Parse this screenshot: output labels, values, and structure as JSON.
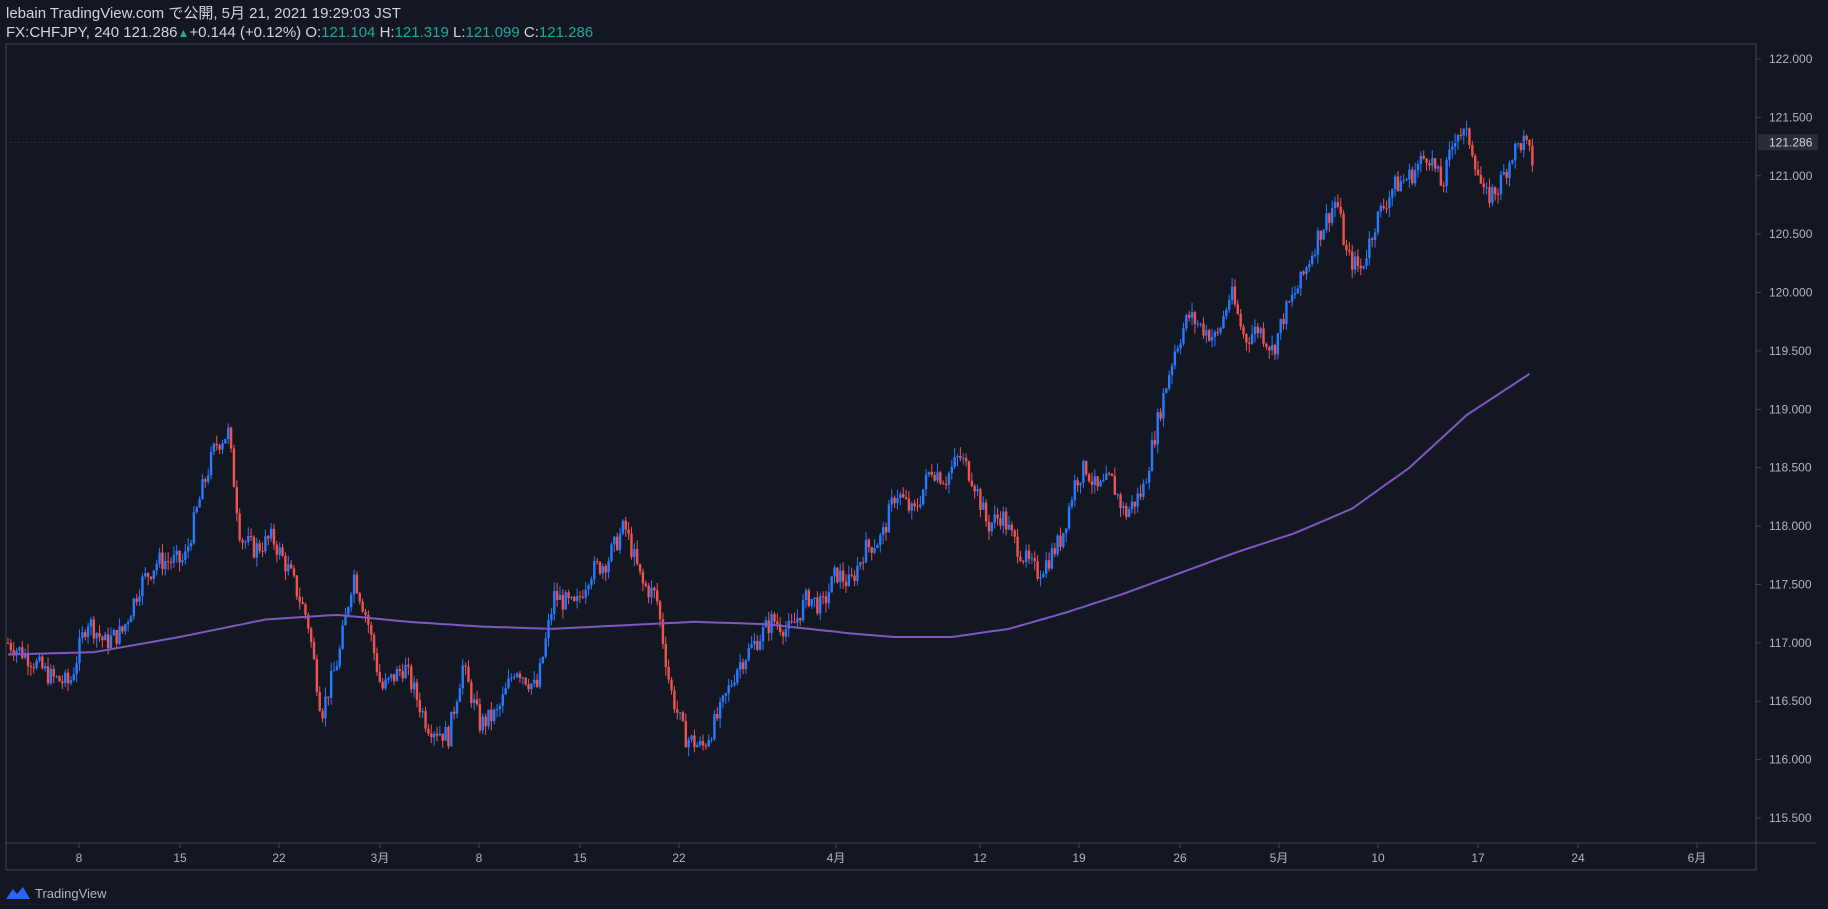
{
  "header": {
    "published": "lebain TradingView.com で公開, 5月 21, 2021 19:29:03 JST",
    "symbol": "FX:CHFJPY, 240",
    "last": "121.286",
    "change_arrow": "▲",
    "change": "+0.144 (+0.12%)",
    "o_label": "O:",
    "o_value": "121.104",
    "h_label": "H:",
    "h_value": "121.319",
    "l_label": "L:",
    "l_value": "121.099",
    "c_label": "C:",
    "c_value": "121.286"
  },
  "footer": {
    "brand": "TradingView"
  },
  "chart_data": {
    "type": "candlestick",
    "colors": {
      "up": "#2979ff",
      "down": "#ef5350",
      "ma": "#7e57c2",
      "bg": "#131722",
      "axis": "#787b86"
    },
    "y_ticks": [
      "122.000",
      "121.500",
      "121.000",
      "120.500",
      "120.000",
      "119.500",
      "119.000",
      "118.500",
      "118.000",
      "117.500",
      "117.000",
      "116.500",
      "116.000",
      "115.500"
    ],
    "ylim": [
      115.3,
      122.25
    ],
    "x_ticks": [
      "8",
      "15",
      "22",
      "3月",
      "8",
      "15",
      "22",
      "4月",
      "12",
      "19",
      "26",
      "5月",
      "10",
      "17",
      "24",
      "6月"
    ],
    "last_price_label": "121.286",
    "last_price": 121.286,
    "close_path": [
      [
        0,
        117.0
      ],
      [
        10,
        116.9
      ],
      [
        25,
        116.7
      ],
      [
        35,
        116.65
      ],
      [
        45,
        117.2
      ],
      [
        55,
        117.0
      ],
      [
        65,
        117.1
      ],
      [
        75,
        117.5
      ],
      [
        85,
        117.7
      ],
      [
        100,
        117.7
      ],
      [
        110,
        118.3
      ],
      [
        118,
        118.7
      ],
      [
        125,
        118.8
      ],
      [
        132,
        117.9
      ],
      [
        140,
        117.8
      ],
      [
        150,
        117.9
      ],
      [
        160,
        117.6
      ],
      [
        170,
        117.2
      ],
      [
        178,
        116.4
      ],
      [
        188,
        116.9
      ],
      [
        196,
        117.6
      ],
      [
        204,
        117.2
      ],
      [
        212,
        116.6
      ],
      [
        225,
        116.8
      ],
      [
        238,
        116.3
      ],
      [
        250,
        116.2
      ],
      [
        258,
        116.8
      ],
      [
        268,
        116.3
      ],
      [
        278,
        116.4
      ],
      [
        288,
        116.8
      ],
      [
        300,
        116.6
      ],
      [
        310,
        117.4
      ],
      [
        322,
        117.3
      ],
      [
        330,
        117.6
      ],
      [
        340,
        117.7
      ],
      [
        350,
        118.0
      ],
      [
        360,
        117.5
      ],
      [
        368,
        117.4
      ],
      [
        376,
        116.6
      ],
      [
        384,
        116.2
      ],
      [
        394,
        116.1
      ],
      [
        404,
        116.4
      ],
      [
        414,
        116.8
      ],
      [
        424,
        117.0
      ],
      [
        434,
        117.2
      ],
      [
        444,
        117.1
      ],
      [
        454,
        117.4
      ],
      [
        462,
        117.3
      ],
      [
        470,
        117.6
      ],
      [
        478,
        117.5
      ],
      [
        486,
        117.8
      ],
      [
        496,
        117.9
      ],
      [
        504,
        118.3
      ],
      [
        514,
        118.1
      ],
      [
        524,
        118.5
      ],
      [
        532,
        118.4
      ],
      [
        540,
        118.6
      ],
      [
        548,
        118.4
      ],
      [
        556,
        118.0
      ],
      [
        564,
        118.1
      ],
      [
        570,
        117.9
      ],
      [
        578,
        117.7
      ],
      [
        584,
        117.6
      ],
      [
        590,
        117.7
      ],
      [
        598,
        117.9
      ],
      [
        606,
        118.4
      ],
      [
        612,
        118.5
      ],
      [
        618,
        118.3
      ],
      [
        626,
        118.4
      ],
      [
        634,
        118.1
      ],
      [
        644,
        118.3
      ],
      [
        654,
        119.0
      ],
      [
        662,
        119.5
      ],
      [
        670,
        119.8
      ],
      [
        678,
        119.7
      ],
      [
        686,
        119.6
      ],
      [
        694,
        120.0
      ],
      [
        702,
        119.6
      ],
      [
        710,
        119.7
      ],
      [
        718,
        119.5
      ],
      [
        724,
        119.8
      ],
      [
        734,
        120.1
      ],
      [
        744,
        120.5
      ],
      [
        754,
        120.8
      ],
      [
        760,
        120.3
      ],
      [
        768,
        120.2
      ],
      [
        776,
        120.6
      ],
      [
        786,
        120.9
      ],
      [
        796,
        121.0
      ],
      [
        806,
        121.2
      ],
      [
        814,
        120.9
      ],
      [
        822,
        121.4
      ],
      [
        830,
        121.3
      ],
      [
        838,
        120.8
      ],
      [
        846,
        120.9
      ],
      [
        854,
        121.2
      ],
      [
        860,
        121.3
      ],
      [
        866,
        121.1
      ]
    ],
    "ma_path": [
      [
        0,
        116.9
      ],
      [
        60,
        116.92
      ],
      [
        120,
        117.05
      ],
      [
        180,
        117.2
      ],
      [
        230,
        117.24
      ],
      [
        280,
        117.18
      ],
      [
        330,
        117.14
      ],
      [
        380,
        117.12
      ],
      [
        430,
        117.15
      ],
      [
        480,
        117.18
      ],
      [
        530,
        117.16
      ],
      [
        560,
        117.12
      ],
      [
        590,
        117.08
      ],
      [
        620,
        117.05
      ],
      [
        660,
        117.05
      ],
      [
        700,
        117.12
      ],
      [
        740,
        117.26
      ],
      [
        780,
        117.42
      ],
      [
        820,
        117.6
      ],
      [
        860,
        117.78
      ],
      [
        900,
        117.94
      ],
      [
        940,
        118.15
      ],
      [
        980,
        118.5
      ],
      [
        1020,
        118.95
      ],
      [
        1066,
        119.32
      ]
    ],
    "n_candles": 1067,
    "series": []
  }
}
